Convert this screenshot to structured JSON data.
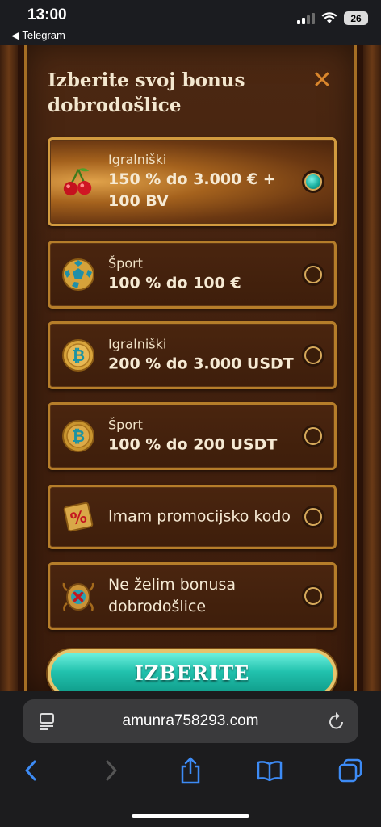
{
  "status_bar": {
    "time": "13:00",
    "back_app": "◀ Telegram",
    "battery": "26"
  },
  "modal": {
    "title": "Izberite svoj bonus dobrodošlice",
    "close_icon": "close-icon",
    "options": [
      {
        "icon": "cherries-icon",
        "label": "Igralniški",
        "value": "150 % do 3.000 € + 100 BV",
        "selected": true
      },
      {
        "icon": "soccer-ball-icon",
        "label": "Šport",
        "value": "100 % do 100 €",
        "selected": false
      },
      {
        "icon": "bitcoin-coin-icon",
        "label": "Igralniški",
        "value": "200 % do 3.000 USDT",
        "selected": false
      },
      {
        "icon": "bitcoin-coin-icon",
        "label": "Šport",
        "value": "100 % do 200 USDT",
        "selected": false
      },
      {
        "icon": "percent-tag-icon",
        "label": "",
        "value": "Imam promocijsko kodo",
        "selected": false
      },
      {
        "icon": "no-bonus-scarab-icon",
        "label": "",
        "value": "Ne želim bonusa dobrodošlice",
        "selected": false
      }
    ],
    "select_button": "IZBERITE"
  },
  "browser": {
    "url": "amunra758293.com"
  },
  "colors": {
    "accent_teal": "#22c2ae",
    "gold_border": "#b57d2a",
    "close_orange": "#d9862c"
  }
}
